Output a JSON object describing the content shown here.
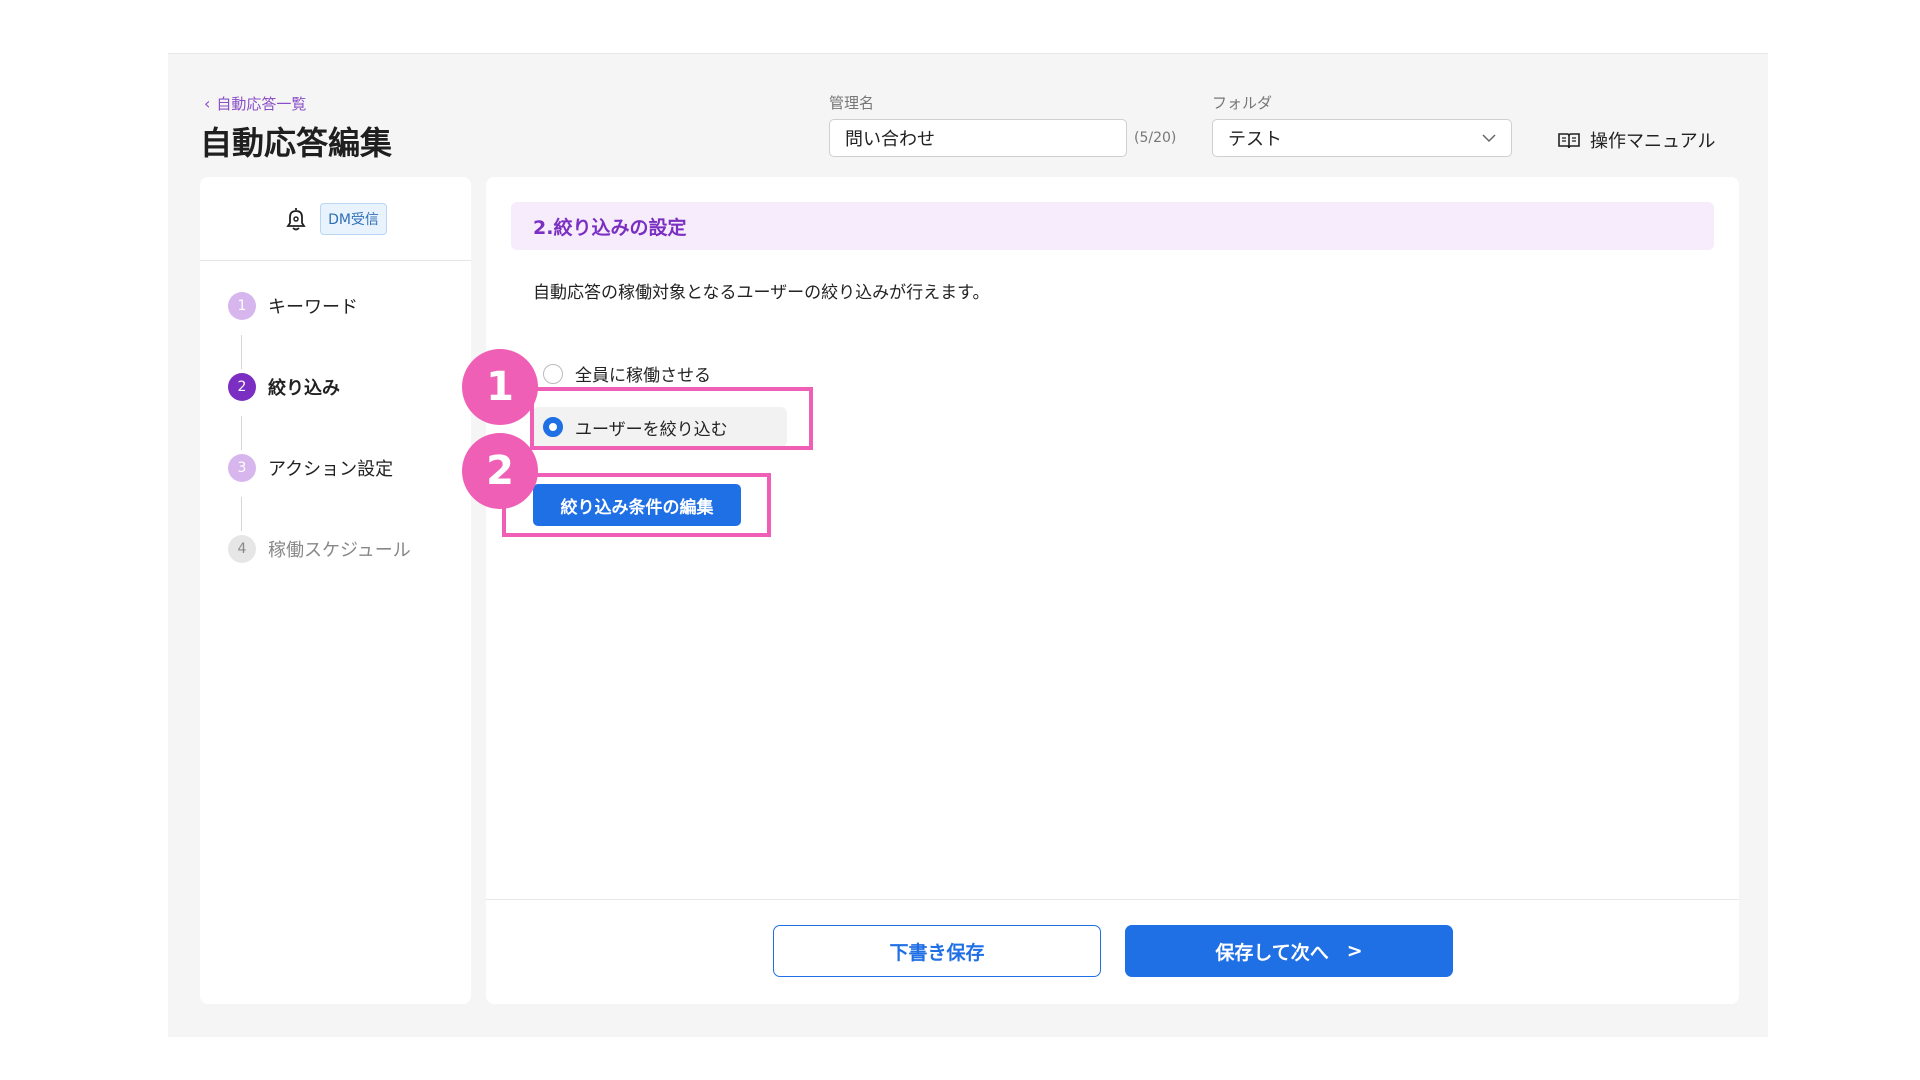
{
  "header": {
    "back_link": "自動応答一覧",
    "title": "自動応答編集",
    "name_label": "管理名",
    "name_value": "問い合わせ",
    "name_count": "(5/20)",
    "folder_label": "フォルダ",
    "folder_value": "テスト",
    "manual_link": "操作マニュアル"
  },
  "sidebar": {
    "trigger_badge": "DM受信",
    "steps": [
      {
        "num": "1",
        "label": "キーワード"
      },
      {
        "num": "2",
        "label": "絞り込み"
      },
      {
        "num": "3",
        "label": "アクション設定"
      },
      {
        "num": "4",
        "label": "稼働スケジュール"
      }
    ]
  },
  "main": {
    "section_title": "2.絞り込みの設定",
    "description": "自動応答の稼働対象となるユーザーの絞り込みが行えます。",
    "radio_all": "全員に稼働させる",
    "radio_filter": "ユーザーを絞り込む",
    "edit_button": "絞り込み条件の編集"
  },
  "footer": {
    "draft_button": "下書き保存",
    "next_button": "保存して次へ",
    "next_arrow": ">"
  },
  "annotations": {
    "marker1": "1",
    "marker2": "2"
  },
  "colors": {
    "accent_purple": "#7b2fc2",
    "primary_blue": "#1f6fe5",
    "highlight_pink": "#ef5fb6"
  }
}
